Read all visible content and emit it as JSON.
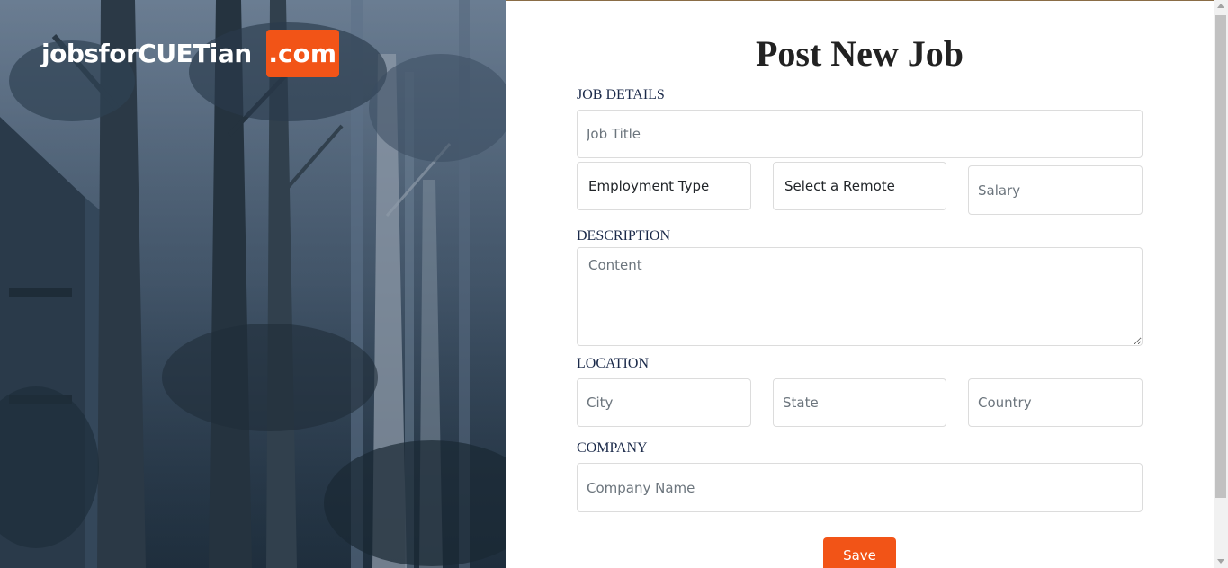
{
  "brand": {
    "name": "jobsforCUETian",
    "tld": ".com",
    "accent_color": "#f25417"
  },
  "page": {
    "title": "Post New Job"
  },
  "sections": {
    "job_details": "JOB DETAILS",
    "description": "DESCRIPTION",
    "location": "LOCATION",
    "company": "COMPANY"
  },
  "fields": {
    "job_title": {
      "placeholder": "Job Title",
      "value": ""
    },
    "employment_type": {
      "selected": "Employment Type"
    },
    "remote": {
      "selected": "Select a Remote"
    },
    "salary": {
      "placeholder": "Salary",
      "value": ""
    },
    "content": {
      "placeholder": "Content",
      "value": ""
    },
    "city": {
      "placeholder": "City",
      "value": ""
    },
    "state": {
      "placeholder": "State",
      "value": ""
    },
    "country": {
      "placeholder": "Country",
      "value": ""
    },
    "company_name": {
      "placeholder": "Company Name",
      "value": ""
    }
  },
  "actions": {
    "save_label": "Save"
  }
}
